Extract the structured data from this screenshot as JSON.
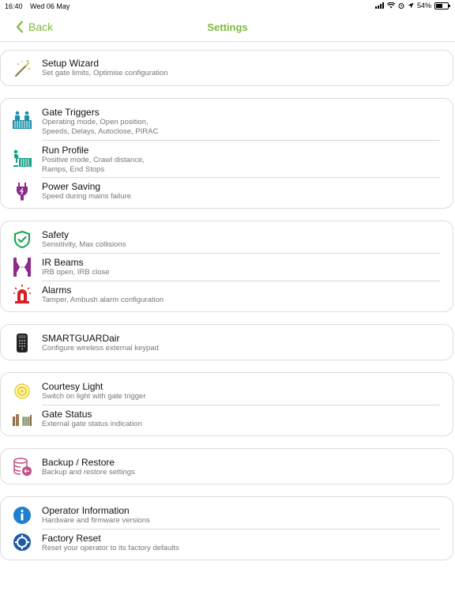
{
  "status": {
    "time": "16:40",
    "date": "Wed 06 May",
    "battery": "54%",
    "battery_level": 0.54
  },
  "nav": {
    "back_label": "Back",
    "title": "Settings"
  },
  "colors": {
    "accent": "#7dbb3c",
    "teal": "#1e8fa8",
    "purple": "#8e2a8e",
    "green": "#16a34a",
    "red": "#d81f26",
    "blue": "#1e6fb5"
  },
  "groups": [
    {
      "items": [
        {
          "title": "Setup Wizard",
          "sub": "Set gate limits, Optimise configuration",
          "icon": "magic-wand-icon"
        }
      ]
    },
    {
      "items": [
        {
          "title": "Gate Triggers",
          "sub": "Operating mode, Open position,\nSpeeds, Delays, Autoclose, PIRAC",
          "icon": "gate-triggers-icon"
        },
        {
          "title": "Run Profile",
          "sub": "Positive mode, Crawl distance,\nRamps, End Stops",
          "icon": "run-profile-icon"
        },
        {
          "title": "Power Saving",
          "sub": "Speed during mains failure",
          "icon": "power-plug-icon"
        }
      ]
    },
    {
      "items": [
        {
          "title": "Safety",
          "sub": "Sensitivity, Max collisions",
          "icon": "shield-check-icon"
        },
        {
          "title": "IR Beams",
          "sub": "IRB open, IRB close",
          "icon": "ir-beams-icon"
        },
        {
          "title": "Alarms",
          "sub": "Tamper, Ambush alarm configuration",
          "icon": "siren-icon"
        }
      ]
    },
    {
      "items": [
        {
          "title": "SMARTGUARDair",
          "sub": "Configure wireless external keypad",
          "icon": "keypad-icon"
        }
      ]
    },
    {
      "items": [
        {
          "title": "Courtesy Light",
          "sub": "Switch on light with gate trigger",
          "icon": "light-bulb-icon"
        },
        {
          "title": "Gate Status",
          "sub": "External gate status indication",
          "icon": "gate-status-icon"
        }
      ]
    },
    {
      "items": [
        {
          "title": "Backup / Restore",
          "sub": "Backup and restore settings",
          "icon": "database-restore-icon"
        }
      ]
    },
    {
      "items": [
        {
          "title": "Operator Information",
          "sub": "Hardware and firmware versions",
          "icon": "info-icon"
        },
        {
          "title": "Factory Reset",
          "sub": "Reset your operator to its factory defaults",
          "icon": "reset-icon"
        }
      ]
    }
  ]
}
